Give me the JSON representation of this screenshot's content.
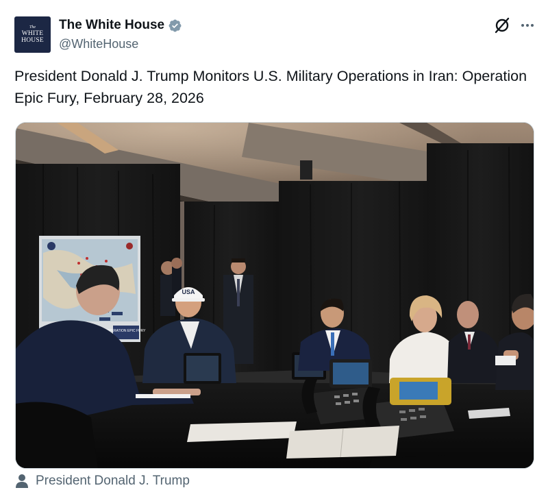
{
  "post": {
    "author": {
      "display_name": "The White House",
      "handle": "@WhiteHouse",
      "verified": true,
      "verified_color": "#1d9bf0",
      "avatar": {
        "line_small": "The",
        "line_1": "WHITE",
        "line_2": "HOUSE",
        "background": "#1c2744"
      }
    },
    "actions": {
      "grok_icon": "grok-icon",
      "more_icon": "more-horizontal-icon"
    },
    "text": "President Donald J. Trump Monitors U.S. Military Operations in Iran: Operation Epic Fury, February 28, 2026",
    "media": {
      "type": "photo",
      "hat_text": "USA",
      "map_caption": "OPERATION EPIC FURY"
    },
    "tagged": {
      "icon": "person-icon",
      "label": "President Donald J. Trump"
    }
  }
}
